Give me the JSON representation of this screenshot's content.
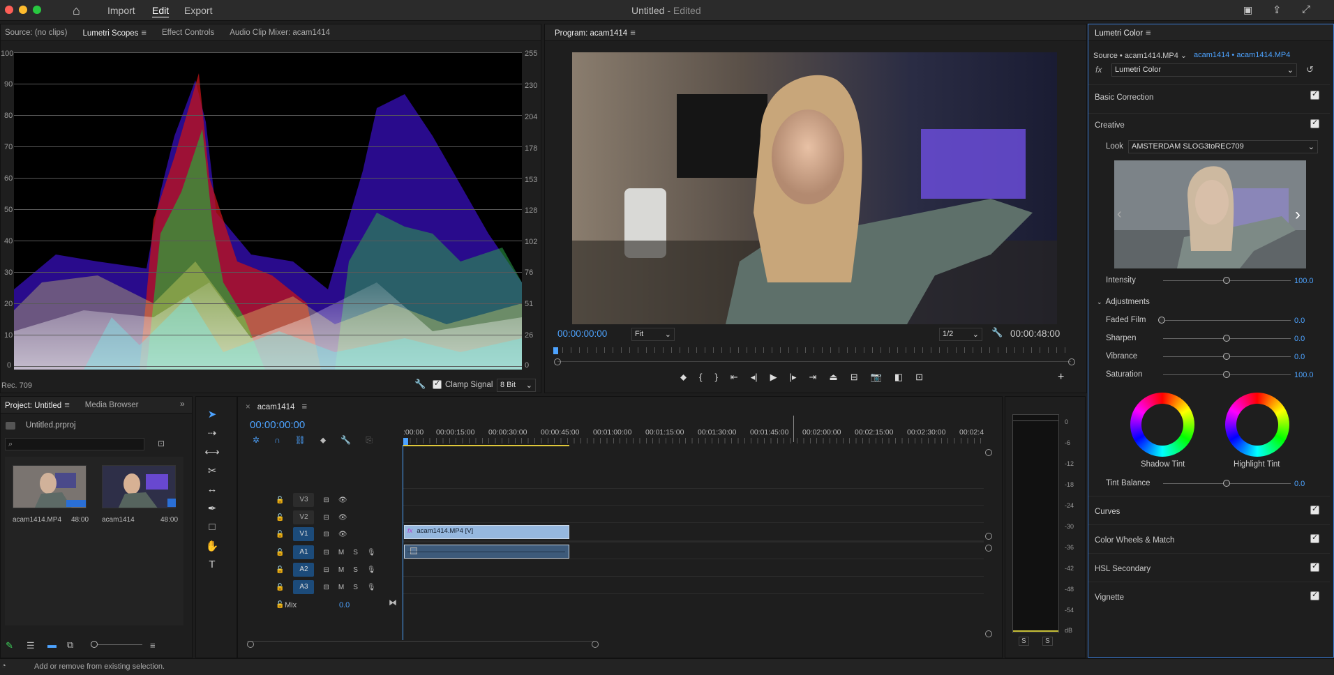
{
  "titlebar": {
    "menu": [
      "Import",
      "Edit",
      "Export"
    ],
    "active_menu": "Edit",
    "doc_title": "Untitled",
    "doc_state": " - Edited"
  },
  "source_panel": {
    "tabs": [
      "Source: (no clips)",
      "Lumetri Scopes",
      "Effect Controls",
      "Audio Clip Mixer: acam1414"
    ],
    "active_tab": "Lumetri Scopes",
    "left_axis": [
      "100",
      "90",
      "80",
      "70",
      "60",
      "50",
      "40",
      "30",
      "20",
      "10",
      "0"
    ],
    "right_axis": [
      "255",
      "230",
      "204",
      "178",
      "153",
      "128",
      "102",
      "76",
      "51",
      "26",
      "0"
    ],
    "color_space": "Rec. 709",
    "clamp_label": "Clamp Signal",
    "bit_depth": "8 Bit"
  },
  "program_panel": {
    "title": "Program: acam1414",
    "timecode": "00:00:00:00",
    "fit": "Fit",
    "resolution": "1/2",
    "duration": "00:00:48:00"
  },
  "lumetri": {
    "title": "Lumetri Color",
    "source": "Source • acam1414.MP4",
    "clip": "acam1414 • acam1414.MP4",
    "fx": "fx",
    "effect": "Lumetri Color",
    "basic_correction": "Basic Correction",
    "creative": "Creative",
    "look_label": "Look",
    "look_value": "AMSTERDAM SLOG3toREC709",
    "intensity_label": "Intensity",
    "intensity_value": "100.0",
    "intensity_level": 0.5,
    "adjustments": "Adjustments",
    "faded_label": "Faded Film",
    "faded_value": "0.0",
    "sharpen_label": "Sharpen",
    "sharpen_value": "0.0",
    "vibrance_label": "Vibrance",
    "vibrance_value": "0.0",
    "saturation_label": "Saturation",
    "saturation_value": "100.0",
    "shadow_tint": "Shadow Tint",
    "highlight_tint": "Highlight Tint",
    "tint_balance_label": "Tint Balance",
    "tint_balance_value": "0.0",
    "curves": "Curves",
    "color_wheels": "Color Wheels & Match",
    "hsl": "HSL Secondary",
    "vignette": "Vignette"
  },
  "project_panel": {
    "tabs": [
      "Project: Untitled",
      "Media Browser"
    ],
    "file": "Untitled.prproj",
    "items": [
      {
        "name": "acam1414.MP4",
        "duration": "48:00"
      },
      {
        "name": "acam1414",
        "duration": "48:00"
      }
    ]
  },
  "timeline": {
    "tab": "acam1414",
    "timecode": "00:00:00:00",
    "ruler": [
      ":00:00",
      "00:00:15:00",
      "00:00:30:00",
      "00:00:45:00",
      "00:01:00:00",
      "00:01:15:00",
      "00:01:30:00",
      "00:01:45:00",
      "00:02:00:00",
      "00:02:15:00",
      "00:02:30:00",
      "00:02:4"
    ],
    "video_tracks": [
      "V3",
      "V2",
      "V1"
    ],
    "audio_tracks": [
      "A1",
      "A2",
      "A3"
    ],
    "mix_label": "Mix",
    "mix_value": "0.0",
    "video_clip": "acam1414.MP4 [V]",
    "m": "M",
    "s": "S"
  },
  "meters": {
    "labels": [
      "0",
      "-6",
      "-12",
      "-18",
      "-24",
      "-30",
      "-36",
      "-42",
      "-48",
      "-54",
      "dB"
    ],
    "solo": [
      "S",
      "S"
    ]
  },
  "status": {
    "text": "Add or remove from existing selection."
  }
}
